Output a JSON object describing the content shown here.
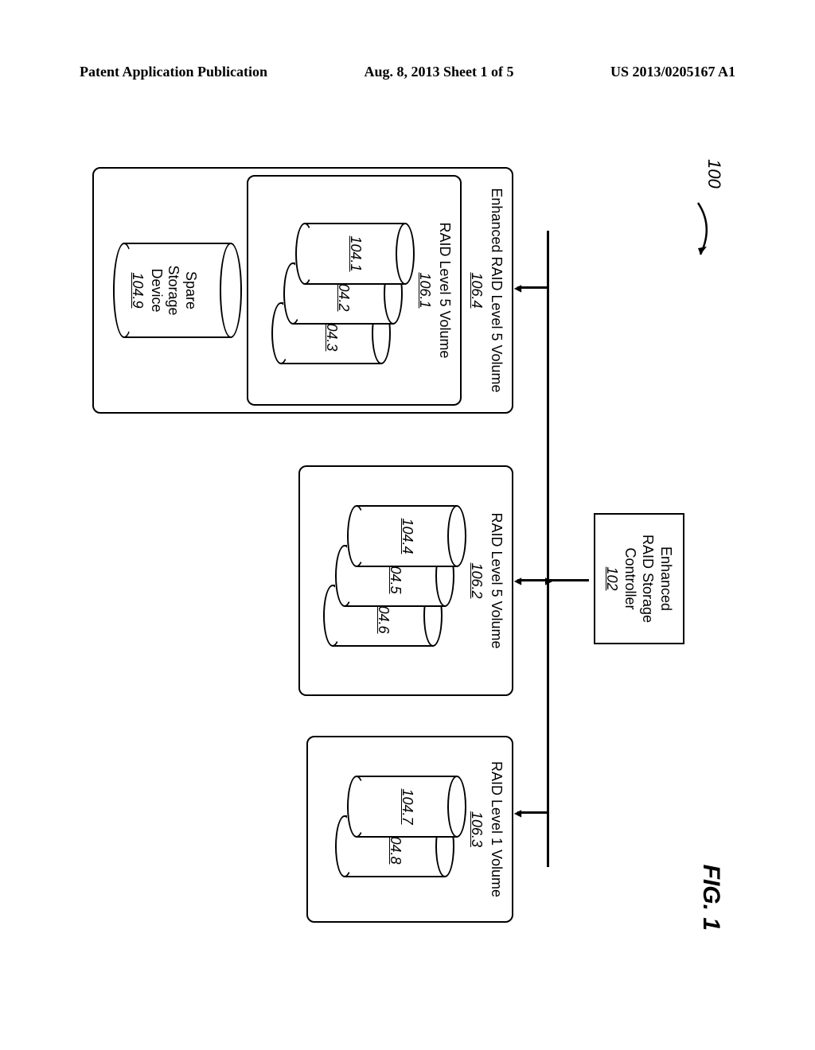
{
  "header": {
    "left": "Patent Application Publication",
    "center": "Aug. 8, 2013  Sheet 1 of 5",
    "right": "US 2013/0205167 A1"
  },
  "figure": {
    "label": "FIG. 1",
    "system_ref": "100",
    "controller": {
      "line1": "Enhanced",
      "line2": "RAID Storage",
      "line3": "Controller",
      "ref": "102"
    },
    "vol_enhanced": {
      "title": "Enhanced RAID Level 5 Volume",
      "ref": "106.4",
      "inner_title": "RAID Level 5 Volume",
      "inner_ref": "106.1",
      "disks": [
        "104.1",
        "104.2",
        "104.3"
      ],
      "spare_label": "Spare\nStorage\nDevice",
      "spare_ref": "104.9"
    },
    "vol_raid5": {
      "title": "RAID Level 5 Volume",
      "ref": "106.2",
      "disks": [
        "104.4",
        "104.5",
        "104.6"
      ]
    },
    "vol_raid1": {
      "title": "RAID Level 1 Volume",
      "ref": "106.3",
      "disks": [
        "104.7",
        "104.8"
      ]
    }
  }
}
